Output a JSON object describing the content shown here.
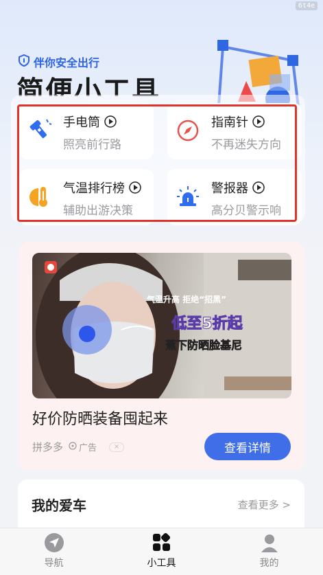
{
  "corner_badge": "6t4e",
  "hero": {
    "tag": "伴你安全出行",
    "title": "简便小工具"
  },
  "tools": [
    {
      "name": "手电筒",
      "sub": "照亮前行路",
      "icon": "flashlight-icon",
      "color": "#2f6df0"
    },
    {
      "name": "指南针",
      "sub": "不再迷失方向",
      "icon": "compass-icon",
      "color": "#e8524a"
    },
    {
      "name": "气温排行榜",
      "sub": "辅助出游决策",
      "icon": "thermometer-icon",
      "color": "#f4a322"
    },
    {
      "name": "警报器",
      "sub": "高分贝警示响",
      "icon": "alarm-siren-icon",
      "color": "#2f6df0"
    }
  ],
  "ad": {
    "banner_line1": "气温升高 拒绝“招黑”",
    "banner_line2": "低至5折起",
    "banner_line3": "蕉下防晒脸基尼",
    "title": "好价防晒装备囤起来",
    "source": "拼多多",
    "ad_label": "广告",
    "close": "×",
    "cta": "查看详情"
  },
  "car": {
    "title": "我的爱车",
    "more": "查看更多 >"
  },
  "tabbar": [
    {
      "label": "导航",
      "icon": "navigation-icon",
      "active": false
    },
    {
      "label": "小工具",
      "icon": "tools-grid-icon",
      "active": true
    },
    {
      "label": "我的",
      "icon": "profile-icon",
      "active": false
    }
  ],
  "colors": {
    "accent": "#3f6ee8",
    "highlight": "#e0332b"
  }
}
